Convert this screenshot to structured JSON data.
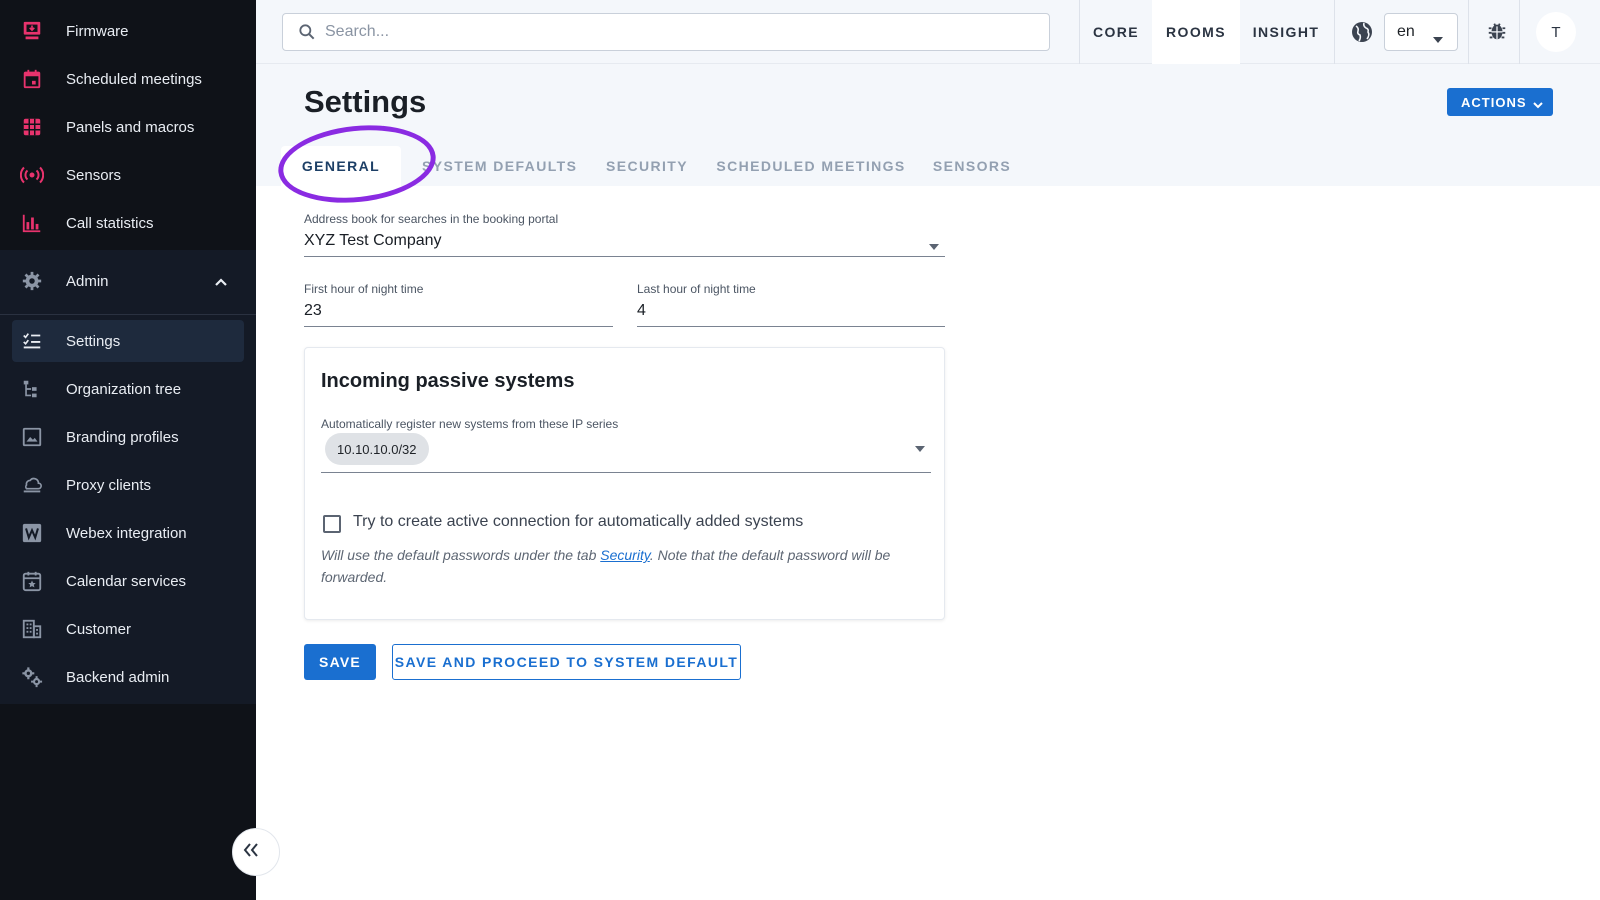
{
  "sidebar": {
    "items": [
      {
        "label": "Firmware",
        "icon": "firmware-icon"
      },
      {
        "label": "Scheduled meetings",
        "icon": "calendar-icon"
      },
      {
        "label": "Panels and macros",
        "icon": "grid-icon"
      },
      {
        "label": "Sensors",
        "icon": "sensor-icon"
      },
      {
        "label": "Call statistics",
        "icon": "bar-chart-icon"
      }
    ],
    "admin": {
      "label": "Admin",
      "icon": "gear-icon",
      "expanded": true
    },
    "admin_items": [
      {
        "label": "Settings",
        "icon": "settings-list-icon",
        "active": true
      },
      {
        "label": "Organization tree",
        "icon": "tree-icon"
      },
      {
        "label": "Branding profiles",
        "icon": "image-icon"
      },
      {
        "label": "Proxy clients",
        "icon": "cloud-icon"
      },
      {
        "label": "Webex integration",
        "icon": "webex-icon"
      },
      {
        "label": "Calendar services",
        "icon": "calendar-star-icon"
      },
      {
        "label": "Customer",
        "icon": "building-icon"
      },
      {
        "label": "Backend admin",
        "icon": "gears-icon"
      }
    ]
  },
  "topbar": {
    "search_placeholder": "Search...",
    "nav": [
      {
        "label": "CORE",
        "active": false
      },
      {
        "label": "ROOMS",
        "active": true
      },
      {
        "label": "INSIGHT",
        "active": false
      }
    ],
    "language": "en",
    "avatar_initial": "T"
  },
  "page": {
    "title": "Settings",
    "actions_label": "ACTIONS",
    "tabs": [
      {
        "label": "GENERAL",
        "active": true
      },
      {
        "label": "SYSTEM DEFAULTS",
        "active": false
      },
      {
        "label": "SECURITY",
        "active": false
      },
      {
        "label": "SCHEDULED MEETINGS",
        "active": false
      },
      {
        "label": "SENSORS",
        "active": false
      }
    ]
  },
  "form": {
    "address_book": {
      "label": "Address book for searches in the booking portal",
      "value": "XYZ Test Company"
    },
    "night_first": {
      "label": "First hour of night time",
      "value": "23"
    },
    "night_last": {
      "label": "Last hour of night time",
      "value": "4"
    },
    "passive": {
      "title": "Incoming passive systems",
      "ip_label": "Automatically register new systems from these IP series",
      "ip_chips": [
        "10.10.10.0/32"
      ],
      "checkbox_label": "Try to create active connection for automatically added systems",
      "checkbox_checked": false,
      "helper_before": "Will use the default passwords under the tab ",
      "helper_link": "Security",
      "helper_after": ". Note that the default password will be forwarded."
    }
  },
  "buttons": {
    "save": "SAVE",
    "save_proceed": "SAVE AND PROCEED TO SYSTEM DEFAULT"
  },
  "colors": {
    "accent": "#1a6fd0",
    "sidebar_icon_pink": "#e8336d",
    "sidebar_bg": "#0f1218",
    "annotation_circle": "#8a2be2"
  }
}
